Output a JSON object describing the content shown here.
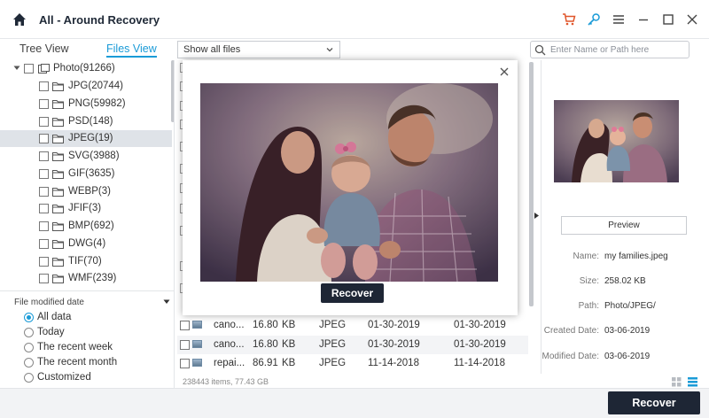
{
  "window": {
    "title": "All - Around Recovery",
    "icons": [
      "home-icon",
      "cart-icon",
      "key-icon",
      "menu-icon",
      "minimize-icon",
      "maximize-icon",
      "close-icon"
    ]
  },
  "tabs": {
    "tree_view": "Tree View",
    "files_view": "Files View",
    "active": "Files View"
  },
  "filter_select": {
    "value": "Show all files"
  },
  "search": {
    "placeholder": "Enter Name or Path here"
  },
  "tree": {
    "root": {
      "label": "Photo(91266)"
    },
    "items": [
      {
        "label": "JPG(20744)"
      },
      {
        "label": "PNG(59982)"
      },
      {
        "label": "PSD(148)"
      },
      {
        "label": "JPEG(19)",
        "selected": true
      },
      {
        "label": "SVG(3988)"
      },
      {
        "label": "GIF(3635)"
      },
      {
        "label": "WEBP(3)"
      },
      {
        "label": "JFIF(3)"
      },
      {
        "label": "BMP(692)"
      },
      {
        "label": "DWG(4)"
      },
      {
        "label": "TIF(70)"
      },
      {
        "label": "WMF(239)"
      }
    ]
  },
  "date_filter": {
    "heading": "File modified date",
    "options": [
      {
        "label": "All data",
        "selected": true
      },
      {
        "label": "Today"
      },
      {
        "label": "The recent week"
      },
      {
        "label": "The recent month"
      },
      {
        "label": "Customized"
      }
    ]
  },
  "file_rows": [
    {
      "name": "cano...",
      "size": "16.80",
      "unit": "KB",
      "type": "JPEG",
      "created": "01-30-2019",
      "modified": "01-30-2019"
    },
    {
      "name": "cano...",
      "size": "16.80",
      "unit": "KB",
      "type": "JPEG",
      "created": "01-30-2019",
      "modified": "01-30-2019"
    },
    {
      "name": "repai...",
      "size": "86.91",
      "unit": "KB",
      "type": "JPEG",
      "created": "11-14-2018",
      "modified": "11-14-2018"
    }
  ],
  "status": {
    "summary": "238443 items, 77.43  GB"
  },
  "preview_panel": {
    "preview_button": "Preview",
    "meta": [
      {
        "label": "Name:",
        "value": "my families.jpeg"
      },
      {
        "label": "Size:",
        "value": "258.02  KB"
      },
      {
        "label": "Path:",
        "value": "Photo/JPEG/"
      },
      {
        "label": "Created Date:",
        "value": "03-06-2019"
      },
      {
        "label": "Modified Date:",
        "value": "03-06-2019"
      }
    ]
  },
  "modal": {
    "recover_label": "Recover"
  },
  "footer": {
    "recover_label": "Recover"
  },
  "colors": {
    "accent": "#1a9bd7",
    "dark_button": "#1e2635",
    "selected_row": "#dfe3e8",
    "cart_icon": "#e0562b"
  }
}
